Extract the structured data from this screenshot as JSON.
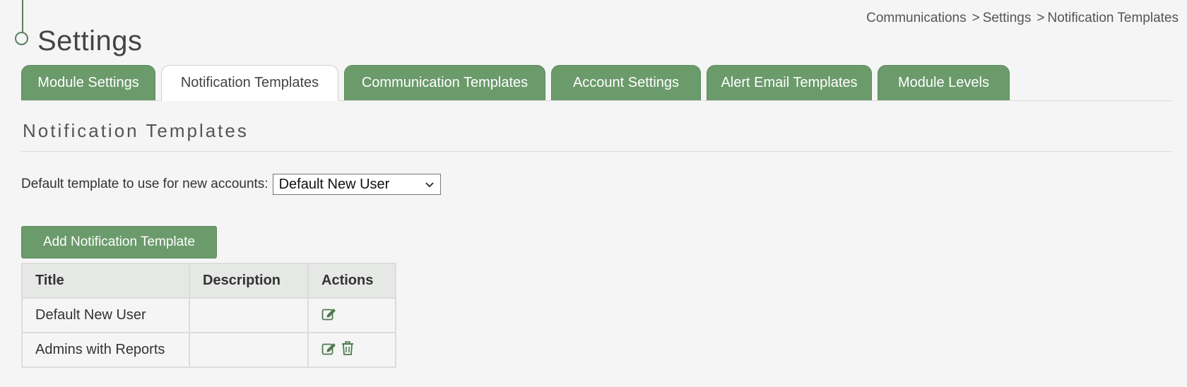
{
  "header": {
    "title": "Settings",
    "breadcrumb": [
      "Communications",
      "Settings",
      "Notification Templates"
    ],
    "breadcrumb_separator": ">"
  },
  "tabs": [
    {
      "label": "Module Settings",
      "active": false
    },
    {
      "label": "Notification Templates",
      "active": true
    },
    {
      "label": "Communication Templates",
      "active": false
    },
    {
      "label": "Account Settings",
      "active": false
    },
    {
      "label": "Alert Email Templates",
      "active": false
    },
    {
      "label": "Module Levels",
      "active": false
    }
  ],
  "section": {
    "title": "Notification Templates",
    "default_label": "Default template to use for new accounts:",
    "default_value": "Default New User",
    "add_button_label": "Add Notification Template"
  },
  "table": {
    "headers": [
      "Title",
      "Description",
      "Actions"
    ],
    "rows": [
      {
        "title": "Default New User",
        "description": "",
        "actions": [
          "edit-icon"
        ]
      },
      {
        "title": "Admins with Reports",
        "description": "",
        "actions": [
          "edit-icon",
          "trash-icon"
        ]
      }
    ]
  },
  "colors": {
    "accent_green": "#6b9a6b",
    "accent_green_border": "#5d8a5d",
    "background": "#f4f5f4",
    "header_cell": "#e6e8e6"
  }
}
